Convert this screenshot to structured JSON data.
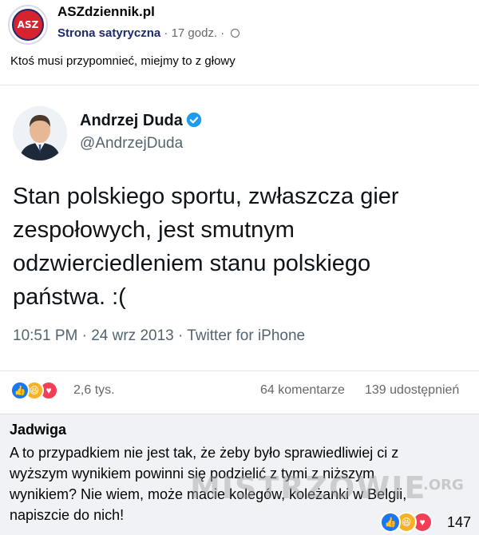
{
  "post": {
    "page_name": "ASZdziennik.pl",
    "avatar_text": "ASZ",
    "subtitle": "Strona satyryczna",
    "separator": " · ",
    "time": "17 godz.",
    "caption": "Ktoś musi przypomnieć, miejmy to z głowy"
  },
  "tweet": {
    "author_name": "Andrzej Duda",
    "handle": "@AndrzejDuda",
    "text": "Stan polskiego sportu, zwłaszcza gier zespołowych, jest smutnym odzwierciedleniem stanu polskiego państwa. :(",
    "meta": "10:51 PM · 24 wrz 2013 · Twitter for iPhone",
    "verified_color": "#1d9bf0"
  },
  "reactions": {
    "icons": [
      "like-icon",
      "haha-icon",
      "love-icon"
    ],
    "count": "2,6 tys.",
    "comments": "64 komentarze",
    "shares": "139 udostępnień"
  },
  "comment": {
    "author": "Jadwiga",
    "text": "A to przypadkiem nie jest tak, że żeby było sprawiedliwiej ci z wyższym wynikiem powinni się podzielić z tymi z niższym wynikiem? Nie wiem, może macie kolegów, koleżanki w Belgii, napiszcie do nich!",
    "reaction_count": "147",
    "watermark": "MISTRZOWIE",
    "watermark_suffix": ".ORG"
  },
  "colors": {
    "like": "#1877f2",
    "haha": "#f7b125",
    "love": "#f33e58",
    "brand_red": "#d6232f",
    "brand_navy": "#1d2a6b"
  }
}
